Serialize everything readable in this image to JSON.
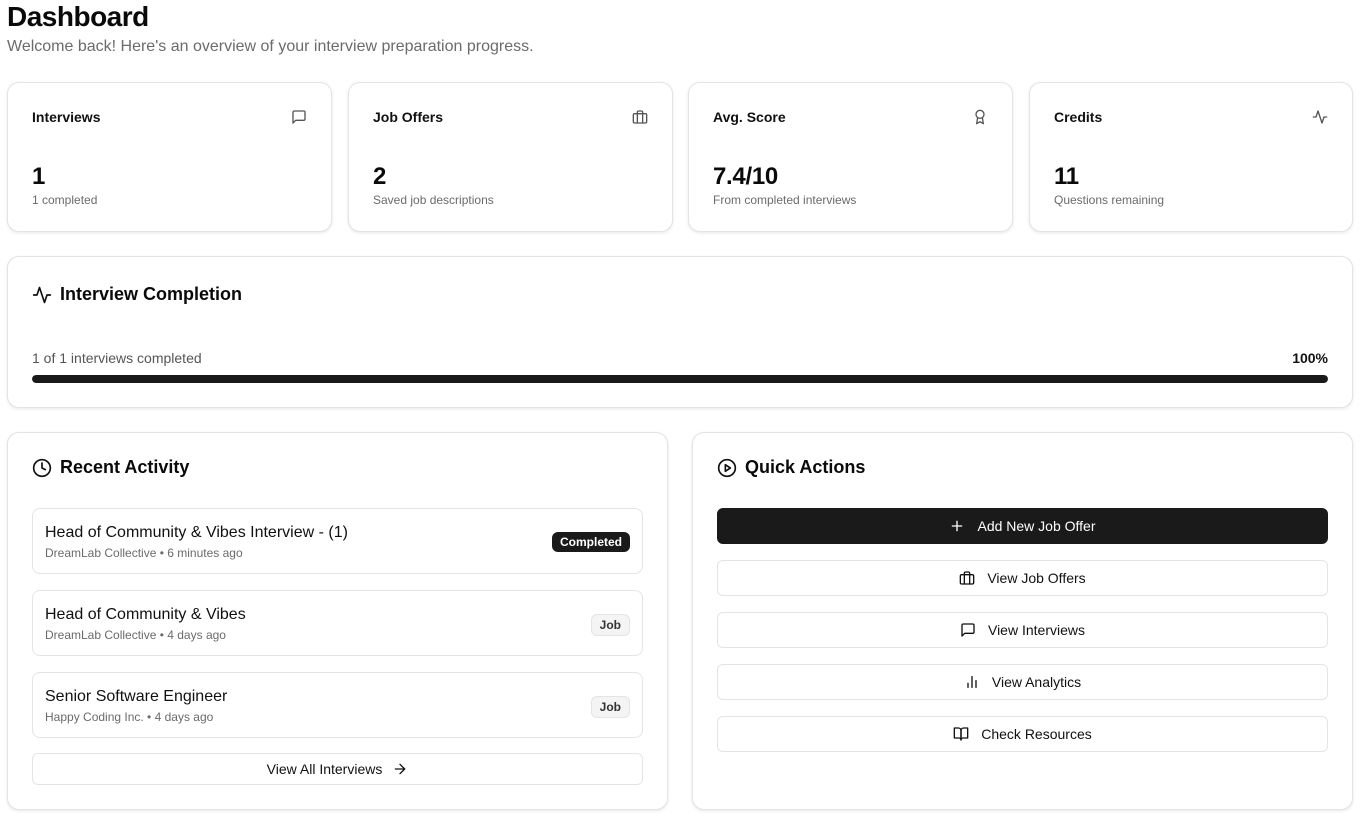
{
  "header": {
    "title": "Dashboard",
    "subtitle": "Welcome back! Here's an overview of your interview preparation progress."
  },
  "stats": [
    {
      "label": "Interviews",
      "value": "1",
      "sub": "1 completed",
      "icon": "message-square-icon"
    },
    {
      "label": "Job Offers",
      "value": "2",
      "sub": "Saved job descriptions",
      "icon": "briefcase-icon"
    },
    {
      "label": "Avg. Score",
      "value": "7.4/10",
      "sub": "From completed interviews",
      "icon": "award-icon"
    },
    {
      "label": "Credits",
      "value": "11",
      "sub": "Questions remaining",
      "icon": "activity-icon"
    }
  ],
  "completion": {
    "title": "Interview Completion",
    "summary": "1 of 1 interviews completed",
    "percent_label": "100%",
    "progress": 1.0
  },
  "activity": {
    "title": "Recent Activity",
    "items": [
      {
        "title": "Head of Community & Vibes Interview - (1)",
        "meta": "DreamLab Collective • 6 minutes ago",
        "badge": "Completed",
        "badge_style": "dark"
      },
      {
        "title": "Head of Community & Vibes",
        "meta": "DreamLab Collective • 4 days ago",
        "badge": "Job",
        "badge_style": "light"
      },
      {
        "title": "Senior Software Engineer",
        "meta": "Happy Coding Inc. • 4 days ago",
        "badge": "Job",
        "badge_style": "light"
      }
    ],
    "view_all_label": "View All Interviews"
  },
  "quick_actions": {
    "title": "Quick Actions",
    "buttons": [
      {
        "label": "Add New Job Offer",
        "icon": "plus-icon",
        "primary": true
      },
      {
        "label": "View Job Offers",
        "icon": "briefcase-icon",
        "primary": false
      },
      {
        "label": "View Interviews",
        "icon": "message-square-icon",
        "primary": false
      },
      {
        "label": "View Analytics",
        "icon": "bar-chart-icon",
        "primary": false
      },
      {
        "label": "Check Resources",
        "icon": "book-open-icon",
        "primary": false
      }
    ]
  }
}
